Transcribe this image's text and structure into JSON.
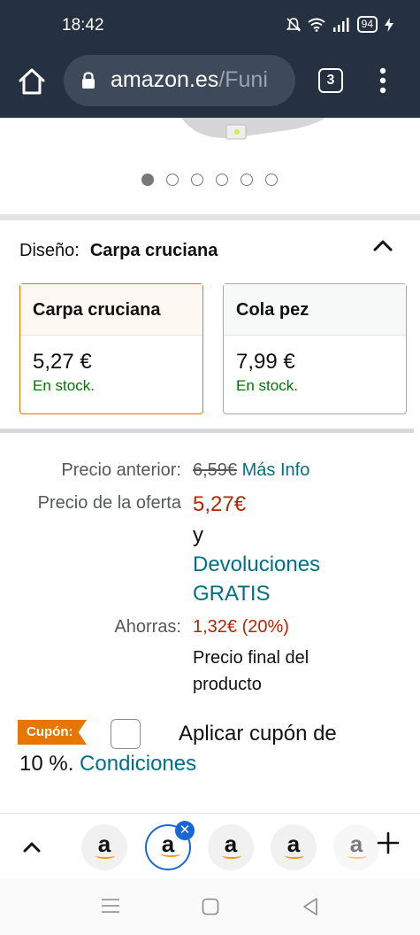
{
  "status_bar": {
    "time": "18:42",
    "battery": "94",
    "icons": [
      "mute-icon",
      "wifi-icon",
      "signal-icon",
      "battery-icon",
      "charging-icon"
    ]
  },
  "browser": {
    "url_domain": "amazon.es",
    "url_path": "/Funi",
    "tab_count": "3"
  },
  "gallery": {
    "image_count": 6,
    "active_index": 0
  },
  "design": {
    "label": "Diseño:",
    "selected": "Carpa cruciana",
    "options": [
      {
        "name": "Carpa cruciana",
        "price": "5,27 €",
        "stock": "En stock.",
        "selected": true
      },
      {
        "name": "Cola pez",
        "price": "7,99 €",
        "stock": "En stock.",
        "selected": false
      }
    ]
  },
  "pricing": {
    "previous_label": "Precio anterior:",
    "previous_value": "6,59€",
    "more_info": "Más Info",
    "offer_label": "Precio de la oferta",
    "offer_value": "5,27€",
    "and_text": "y",
    "returns_line1": "Devoluciones",
    "returns_line2": "GRATIS",
    "savings_label": "Ahorras:",
    "savings_value": "1,32€ (20%)",
    "final_line1": "Precio final del",
    "final_line2": "producto"
  },
  "coupon": {
    "badge": "Cupón:",
    "apply_text": "Aplicar cupón de",
    "percent_text": "10 %.",
    "conditions": "Condiciones",
    "checked": false
  },
  "tab_strip": {
    "tabs": [
      {
        "letter": "a",
        "current": false
      },
      {
        "letter": "a",
        "current": true
      },
      {
        "letter": "a",
        "current": false
      },
      {
        "letter": "a",
        "current": false
      },
      {
        "letter": "a",
        "current": false
      }
    ]
  },
  "colors": {
    "header_bg": "#253040",
    "link": "#007185",
    "price": "#b12704",
    "stock": "#007600",
    "accent": "#e77600",
    "tab_active": "#1967d2"
  }
}
